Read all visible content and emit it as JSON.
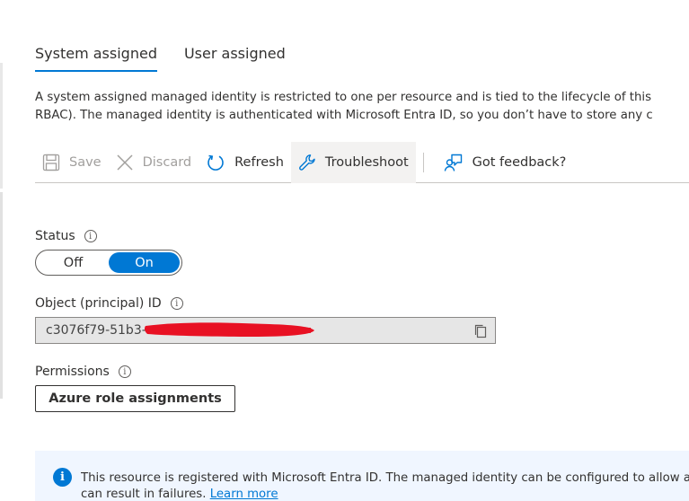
{
  "tabs": [
    {
      "label": "System assigned",
      "active": true
    },
    {
      "label": "User assigned",
      "active": false
    }
  ],
  "description": {
    "line1": "A system assigned managed identity is restricted to one per resource and is tied to the lifecycle of this",
    "line2": "RBAC). The managed identity is authenticated with Microsoft Entra ID, so you don’t have to store any c"
  },
  "toolbar": {
    "save_label": "Save",
    "discard_label": "Discard",
    "refresh_label": "Refresh",
    "troubleshoot_label": "Troubleshoot",
    "feedback_label": "Got feedback?"
  },
  "status": {
    "label": "Status",
    "off_label": "Off",
    "on_label": "On",
    "value": "On"
  },
  "object_id": {
    "label": "Object (principal) ID",
    "value": "c3076f79-51b3-"
  },
  "permissions": {
    "label": "Permissions",
    "button_label": "Azure role assignments"
  },
  "banner": {
    "line1": "This resource is registered with Microsoft Entra ID. The managed identity can be configured to allow ac",
    "line2": "can result in failures. ",
    "link_label": "Learn more"
  },
  "colors": {
    "accent": "#0078d4",
    "redaction": "#e81123",
    "banner_bg": "#f0f6ff"
  }
}
